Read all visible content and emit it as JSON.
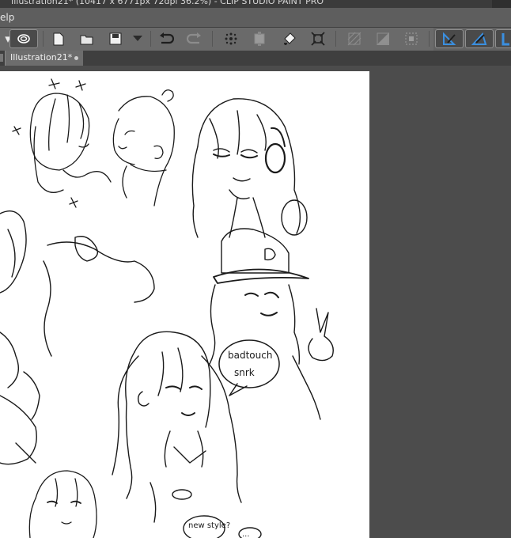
{
  "window": {
    "title": "Illustration21* (10417 x 6771px 72dpi 36.2%) - CLIP STUDIO PAINT PRO"
  },
  "menu": {
    "visible_item": "elp"
  },
  "toolbar": {
    "buttons": [
      {
        "icon": "clip-studio-logo-icon"
      },
      {
        "icon": "new-file-icon"
      },
      {
        "icon": "open-folder-icon"
      },
      {
        "icon": "save-icon"
      },
      {
        "icon": "dropdown-arrow-icon"
      },
      {
        "icon": "undo-icon"
      },
      {
        "icon": "redo-icon"
      },
      {
        "icon": "clear-selection-icon"
      },
      {
        "icon": "transform-icon"
      },
      {
        "icon": "fill-icon"
      },
      {
        "icon": "scale-icon"
      },
      {
        "icon": "disabled-hatch-icon"
      },
      {
        "icon": "disabled-pattern-icon"
      },
      {
        "icon": "disabled-marquee-icon"
      },
      {
        "icon": "ruler-snap-icon"
      },
      {
        "icon": "ruler-perspective-icon"
      },
      {
        "icon": "ruler-grid-icon"
      }
    ],
    "accent_color": "#3a8fe0"
  },
  "tabs": [
    {
      "label": "Illustration21*",
      "modified": true
    }
  ],
  "canvas": {
    "speech_bubble_text_1": "badtouch",
    "speech_bubble_text_2": "snrk",
    "scribble_text": "new style?",
    "dots_text": "..."
  }
}
